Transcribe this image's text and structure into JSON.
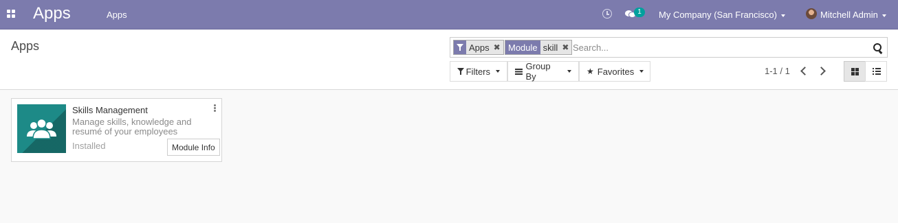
{
  "navbar": {
    "brand": "Apps",
    "menu_items": [
      {
        "label": "Apps"
      }
    ],
    "messages_count": "1",
    "company": "My Company (San Francisco)",
    "user": "Mitchell Admin",
    "bg_color": "#7c7bad"
  },
  "control_panel": {
    "title": "Apps",
    "search": {
      "facets": [
        {
          "icon": "filter-icon",
          "values": [
            "Apps"
          ]
        },
        {
          "label": "Module",
          "values": [
            "skill"
          ]
        }
      ],
      "placeholder": "Search..."
    },
    "buttons": {
      "filters": "Filters",
      "group_by": "Group By",
      "favorites": "Favorites"
    },
    "pager": {
      "value": "1-1 / 1"
    },
    "views": [
      {
        "name": "kanban",
        "icon": "th-large-icon",
        "active": true
      },
      {
        "name": "list",
        "icon": "list-icon",
        "active": false
      }
    ]
  },
  "apps": [
    {
      "name": "Skills Management",
      "summary": "Manage skills, knowledge and resumé of your employees",
      "status": "Installed",
      "action": "Module Info",
      "icon": "people-group-icon",
      "icon_color": "#1d8a87"
    }
  ]
}
